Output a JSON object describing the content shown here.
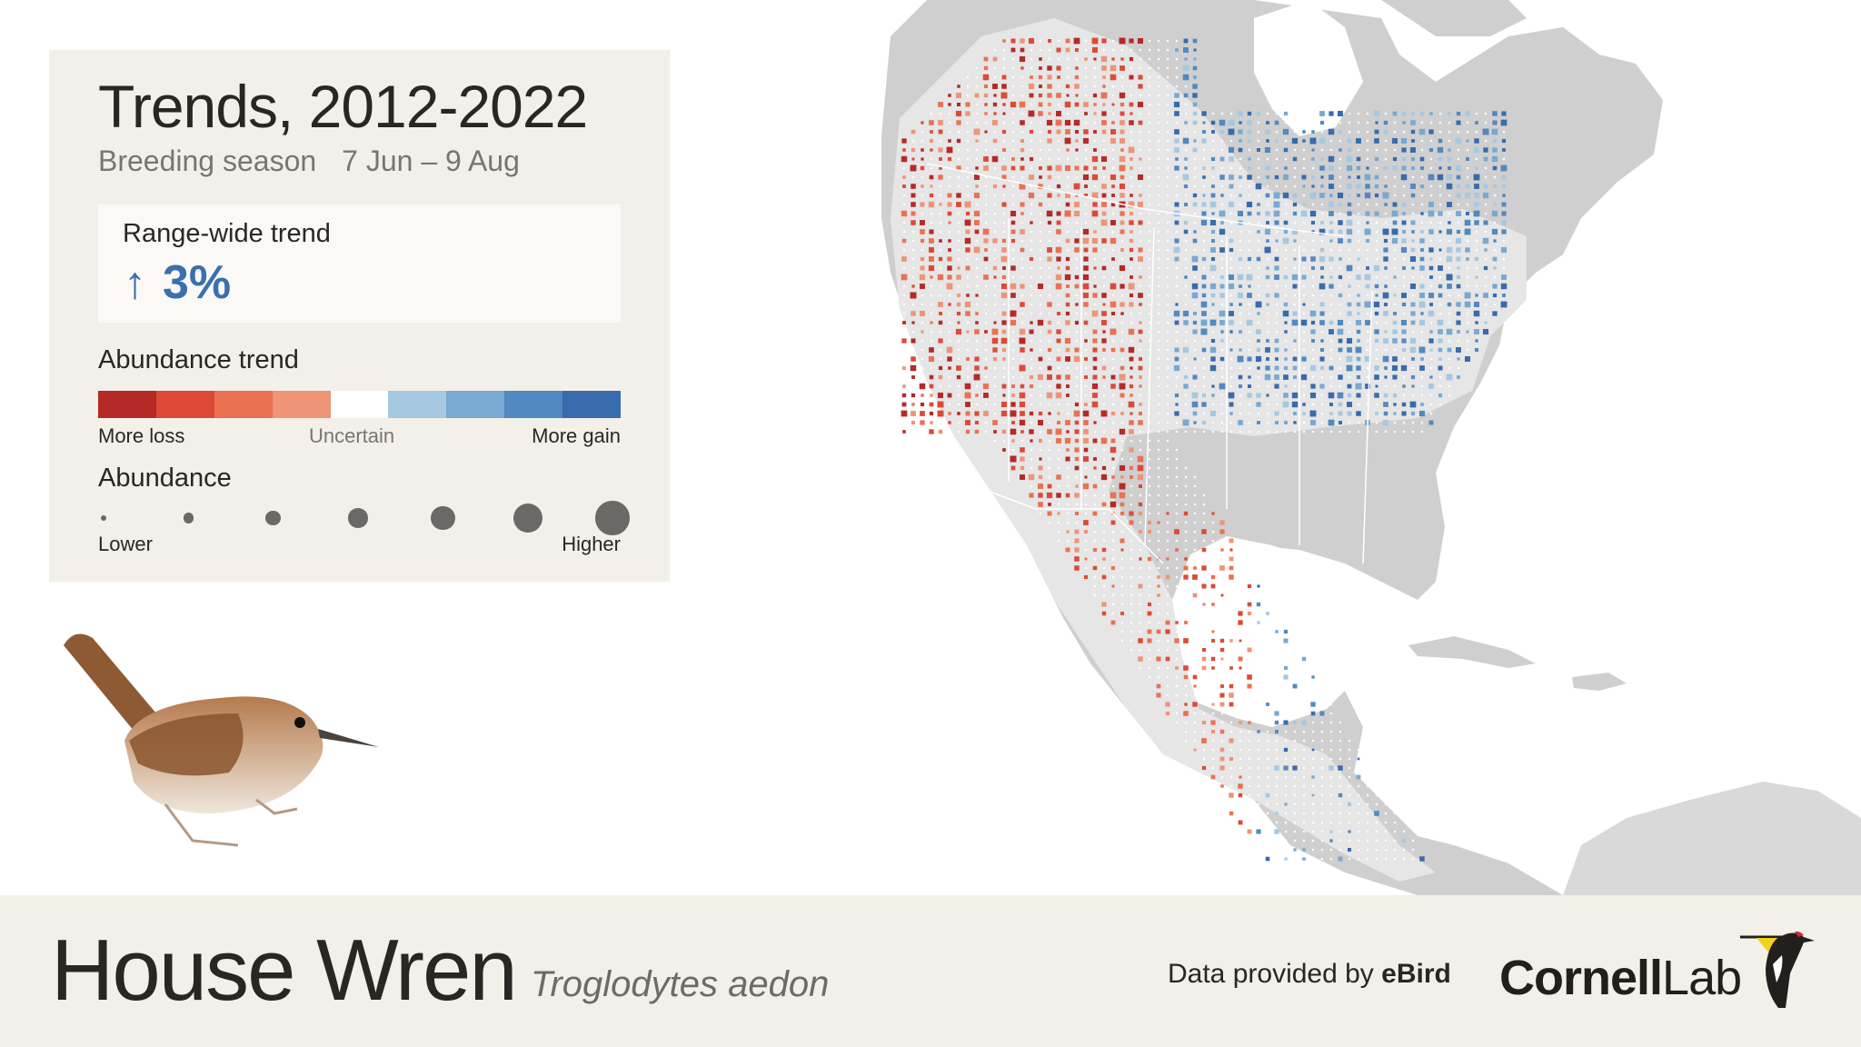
{
  "panel": {
    "title": "Trends, 2012-2022",
    "season_label": "Breeding season",
    "season_dates": "7 Jun – 9 Aug",
    "range_wide": {
      "label": "Range-wide trend",
      "arrow": "↑",
      "value": "3%",
      "color": "#3a6fb0"
    },
    "abundance_trend": {
      "heading": "Abundance trend",
      "colors": [
        "#b52a27",
        "#dc4a37",
        "#ea7152",
        "#ee9477",
        "#ffffff",
        "#a6c8e0",
        "#77a9d1",
        "#5189c0",
        "#376bad"
      ],
      "label_left": "More loss",
      "label_mid": "Uncertain",
      "label_right": "More gain"
    },
    "abundance": {
      "heading": "Abundance",
      "levels": 7,
      "label_left": "Lower",
      "label_right": "Higher",
      "dot_color": "#6b6866"
    }
  },
  "species": {
    "common_name": "House Wren",
    "scientific_name": "Troglodytes aedon"
  },
  "footer": {
    "credit_prefix": "Data provided by",
    "credit_source": "eBird",
    "logo_bold": "Cornell",
    "logo_light": "Lab"
  },
  "map": {
    "land_color": "#cfcfcf",
    "range_color": "#e6e6e6",
    "border_color": "#ffffff",
    "water_color": "#ffffff"
  }
}
